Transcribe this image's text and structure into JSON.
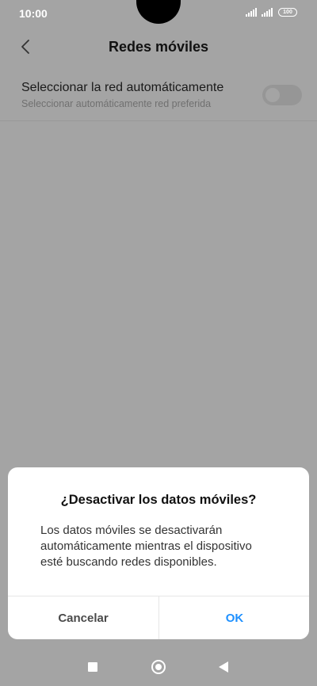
{
  "status_bar": {
    "time": "10:00",
    "battery": "100",
    "icons": [
      "signal-icon",
      "signal-icon",
      "battery-icon"
    ]
  },
  "header": {
    "back_icon": "chevron-left-icon",
    "title": "Redes móviles"
  },
  "setting": {
    "title": "Seleccionar la red automáticamente",
    "subtitle": "Seleccionar automáticamente red preferida",
    "toggle_on": false
  },
  "dialog": {
    "title": "¿Desactivar los datos móviles?",
    "message_lines": [
      "Los datos móviles se desactivarán",
      "automáticamente mientras el dispositivo",
      "esté buscando redes disponibles."
    ],
    "cancel_label": "Cancelar",
    "ok_label": "OK"
  },
  "nav_bar": {
    "icons": [
      "recents-square-icon",
      "home-circle-icon",
      "back-triangle-icon"
    ]
  },
  "colors": {
    "scrim_background": "#a4a4a4",
    "dialog_background": "#ffffff",
    "accent": "#1e90ff"
  }
}
